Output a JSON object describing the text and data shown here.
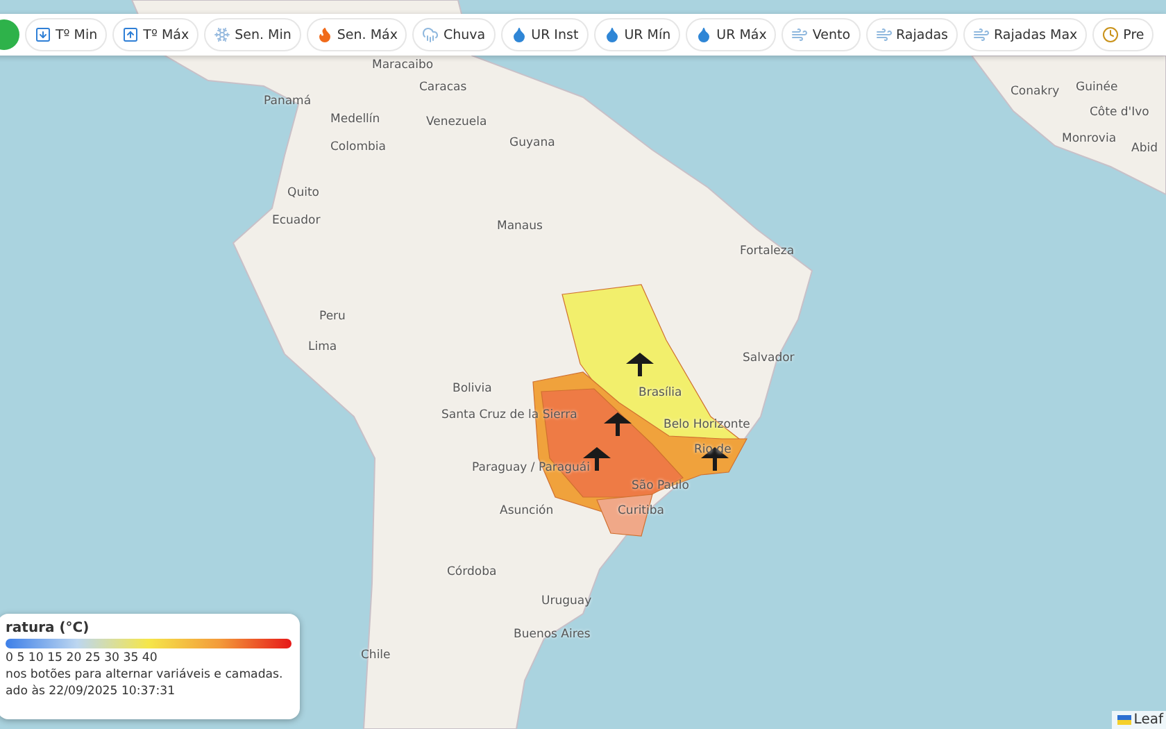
{
  "toolbar": {
    "buttons": [
      {
        "label": "Tº Min"
      },
      {
        "label": "Tº Máx"
      },
      {
        "label": "Sen. Min"
      },
      {
        "label": "Sen. Máx"
      },
      {
        "label": "Chuva"
      },
      {
        "label": "UR Inst"
      },
      {
        "label": "UR Mín"
      },
      {
        "label": "UR Máx"
      },
      {
        "label": "Vento"
      },
      {
        "label": "Rajadas"
      },
      {
        "label": "Rajadas Max"
      },
      {
        "label": "Pre"
      }
    ]
  },
  "map": {
    "labels": [
      "Maracaibo",
      "Caracas",
      "Panamá",
      "Medellín",
      "Venezuela",
      "Colombia",
      "Guyana",
      "Quito",
      "Ecuador",
      "Manaus",
      "Fortaleza",
      "Peru",
      "Lima",
      "Bolivia",
      "Salvador",
      "Brasília",
      "Belo Horizonte",
      "Santa Cruz de la Sierra",
      "Paraguay / Paraguái",
      "Rio de",
      "São Paulo",
      "Asunción",
      "Curitiba",
      "Córdoba",
      "Uruguay",
      "Chile",
      "Buenos Aires",
      "Conakry",
      "Guinée",
      "Côte d'Ivo",
      "Monrovia",
      "Abid"
    ],
    "alert_areas": [
      {
        "color": "#f2ef6c"
      },
      {
        "color": "#f0a23c"
      },
      {
        "color": "#ee7b45"
      },
      {
        "color": "#f0a888"
      }
    ]
  },
  "legend": {
    "title": "ratura (°C)",
    "scale": "0 5 10 15 20 25 30 35 40",
    "hint": "nos botões para alternar variáveis e camadas.",
    "updated": "ado às 22/09/2025 10:37:31"
  },
  "attribution": "Leaf"
}
